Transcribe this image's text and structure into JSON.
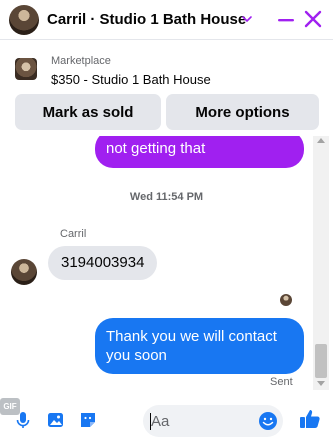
{
  "header": {
    "title": "Carril · Studio 1 Bath House"
  },
  "marketplace": {
    "label": "Marketplace",
    "description": "$350 - Studio 1 Bath House",
    "mark_sold_label": "Mark as sold",
    "more_options_label": "More options"
  },
  "messages": {
    "outgoing_top": "not getting that",
    "timestamp": "Wed 11:54 PM",
    "sender_name": "Carril",
    "incoming": "3194003934",
    "outgoing": "Thank you we will contact you soon",
    "status": "Sent"
  },
  "composer": {
    "placeholder": "Aa",
    "gif_label": "GIF"
  },
  "icons": [
    "avatar",
    "chevron-down-icon",
    "minimize-icon",
    "close-icon",
    "microphone-icon",
    "photo-icon",
    "sticker-icon",
    "gif-icon",
    "emoji-icon",
    "thumbs-up-icon"
  ],
  "colors": {
    "accent": "#a020f0",
    "blue": "#1877f2",
    "button_bg": "#e4e6eb"
  }
}
